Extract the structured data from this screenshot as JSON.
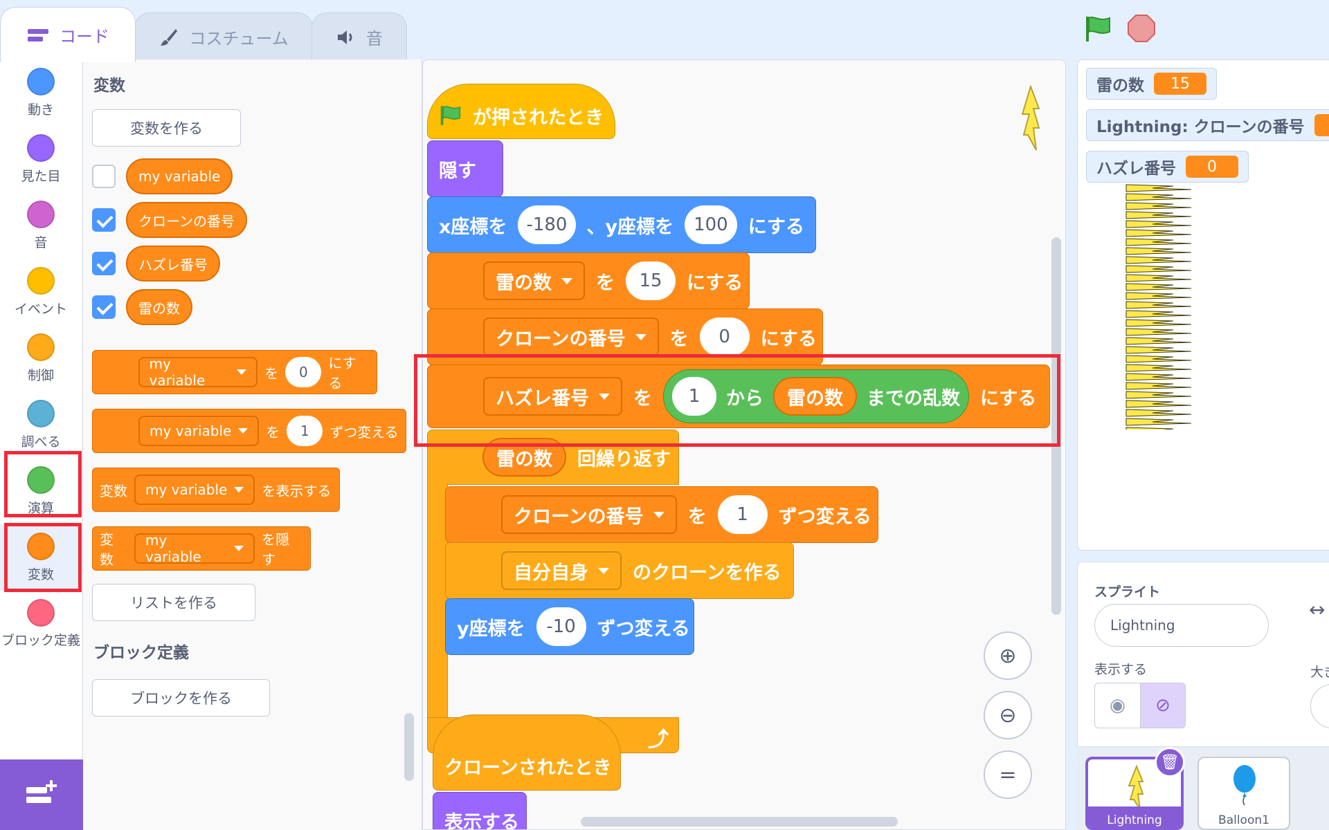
{
  "tabs": [
    {
      "label": "コード",
      "icon": "code-icon"
    },
    {
      "label": "コスチューム",
      "icon": "brush-icon"
    },
    {
      "label": "音",
      "icon": "speaker-icon"
    }
  ],
  "categories": [
    {
      "label": "動き",
      "color": "#4c97ff"
    },
    {
      "label": "見た目",
      "color": "#9966ff"
    },
    {
      "label": "音",
      "color": "#cf63cf"
    },
    {
      "label": "イベント",
      "color": "#ffbf00"
    },
    {
      "label": "制御",
      "color": "#ffab19"
    },
    {
      "label": "調べる",
      "color": "#5cb1d6"
    },
    {
      "label": "演算",
      "color": "#59c059"
    },
    {
      "label": "変数",
      "color": "#ff8c1a"
    },
    {
      "label": "ブロック定義",
      "color": "#ff6680"
    }
  ],
  "palette": {
    "title_variables": "変数",
    "make_variable": "変数を作る",
    "variables": [
      {
        "name": "my variable",
        "checked": false
      },
      {
        "name": "クローンの番号",
        "checked": true
      },
      {
        "name": "ハズレ番号",
        "checked": true
      },
      {
        "name": "雷の数",
        "checked": true
      }
    ],
    "blocks": {
      "set": {
        "var": "my variable",
        "word": "を",
        "value": "0",
        "suffix": "にする"
      },
      "change": {
        "var": "my variable",
        "word": "を",
        "value": "1",
        "suffix": "ずつ変える"
      },
      "show": {
        "prefix": "変数",
        "var": "my variable",
        "suffix": "を表示する"
      },
      "hide": {
        "prefix": "変数",
        "var": "my variable",
        "suffix": "を隠す"
      }
    },
    "make_list": "リストを作る",
    "title_myblocks": "ブロック定義",
    "make_block": "ブロックを作る"
  },
  "script": {
    "hat": "が押されたとき",
    "hide": "隠す",
    "goto": {
      "x_label": "x座標を",
      "x": "-180",
      "y_label": "、y座標を",
      "y": "100",
      "suffix": "にする"
    },
    "set1": {
      "var": "雷の数",
      "word": "を",
      "value": "15",
      "suffix": "にする"
    },
    "set2": {
      "var": "クローンの番号",
      "word": "を",
      "value": "0",
      "suffix": "にする"
    },
    "set3": {
      "var": "ハズレ番号",
      "word": "を",
      "from": "1",
      "from_label": "から",
      "to_var": "雷の数",
      "to_label": "までの乱数",
      "suffix": "にする"
    },
    "repeat": {
      "var": "雷の数",
      "label": "回繰り返す"
    },
    "change1": {
      "var": "クローンの番号",
      "word": "を",
      "value": "1",
      "suffix": "ずつ変える"
    },
    "clone": {
      "target": "自分自身",
      "suffix": "のクローンを作る"
    },
    "change_y": {
      "label": "y座標を",
      "value": "-10",
      "suffix": "ずつ変える"
    },
    "clone_hat": "クローンされたとき",
    "show": "表示する"
  },
  "stage": {
    "monitors": [
      {
        "label": "雷の数",
        "value": "15"
      },
      {
        "label": "Lightning: クローンの番号",
        "value": ""
      },
      {
        "label": "ハズレ番号",
        "value": "0"
      }
    ]
  },
  "sprite_pane": {
    "sprite_label": "スプライト",
    "sprite_name": "Lightning",
    "show_label": "表示する",
    "size_label": "大き",
    "sprites": [
      "Lightning",
      "Balloon1"
    ]
  }
}
